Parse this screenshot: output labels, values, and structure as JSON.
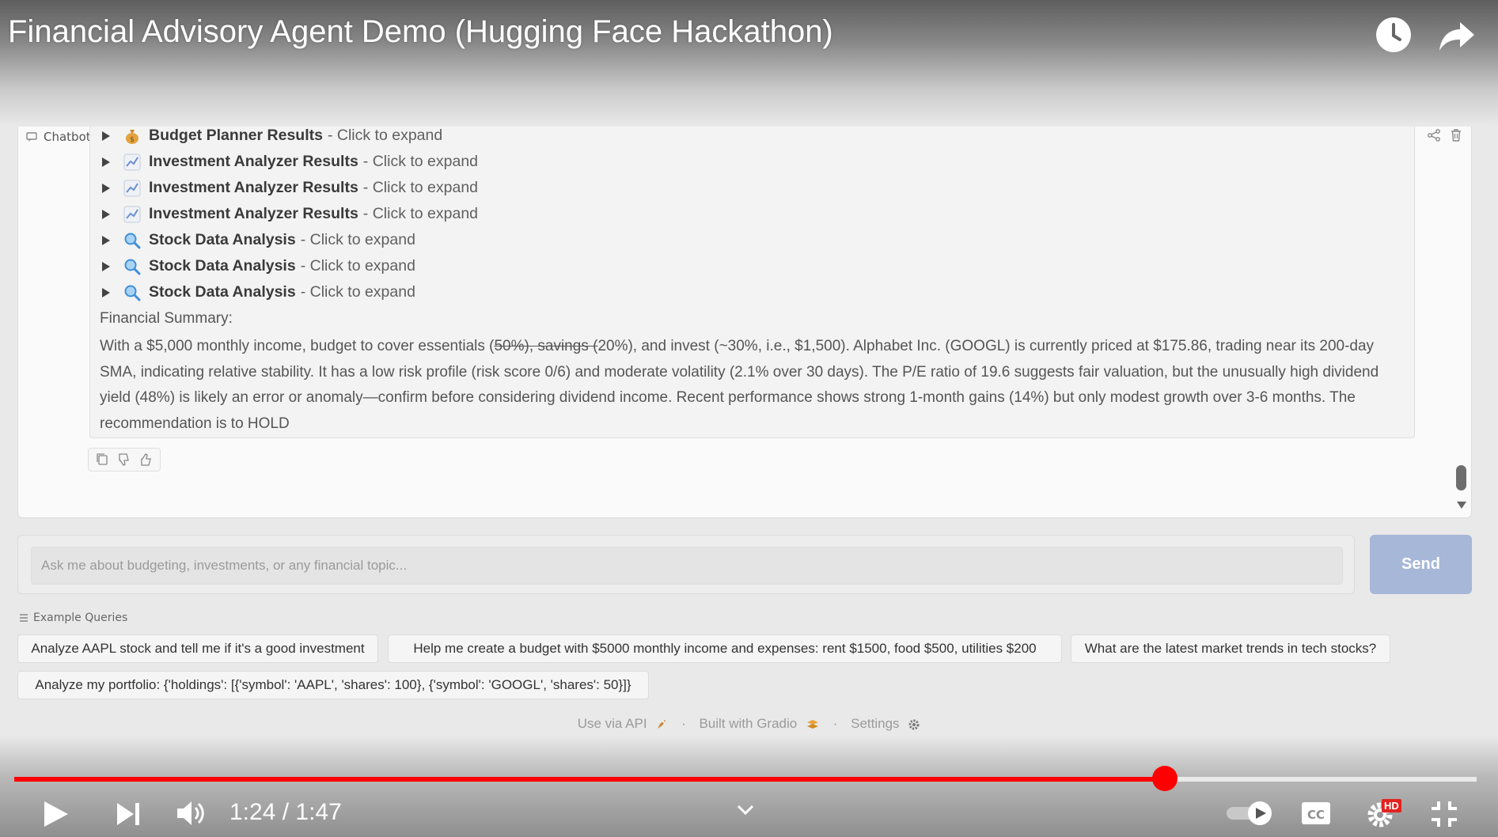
{
  "video": {
    "title": "Financial Advisory Agent Demo (Hugging Face Hackathon)",
    "time": "1:24 / 1:47",
    "progress_percent": 78.6,
    "hd_badge": "HD"
  },
  "chatbot": {
    "label": "Chatbot",
    "details": [
      {
        "icon": "money-bag-icon",
        "title": "Budget Planner Results",
        "hint": "- Click to expand"
      },
      {
        "icon": "chart-icon",
        "title": "Investment Analyzer Results",
        "hint": "- Click to expand"
      },
      {
        "icon": "chart-icon",
        "title": "Investment Analyzer Results",
        "hint": "- Click to expand"
      },
      {
        "icon": "chart-icon",
        "title": "Investment Analyzer Results",
        "hint": "- Click to expand"
      },
      {
        "icon": "magnifier-icon",
        "title": "Stock Data Analysis",
        "hint": "- Click to expand"
      },
      {
        "icon": "magnifier-icon",
        "title": "Stock Data Analysis",
        "hint": "- Click to expand"
      },
      {
        "icon": "magnifier-icon",
        "title": "Stock Data Analysis",
        "hint": "- Click to expand"
      }
    ],
    "summary_title": "Financial Summary:",
    "summary_pre": "With a $5,000 monthly income, budget to cover essentials (",
    "summary_strike": "50%), savings (",
    "summary_post": "20%), and invest (~30%, i.e., $1,500). Alphabet Inc. (GOOGL) is currently priced at $175.86, trading near its 200-day SMA, indicating relative stability. It has a low risk profile (risk score 0/6) and moderate volatility (2.1% over 30 days). The P/E ratio of 19.6 suggests fair valuation, but the unusually high dividend yield (48%) is likely an error or anomaly—confirm before considering dividend income. Recent performance shows strong 1-month gains (14%) but only modest growth over 3-6 months. The recommendation is to HOLD"
  },
  "input": {
    "placeholder": "Ask me about budgeting, investments, or any financial topic...",
    "send_label": "Send"
  },
  "examples": {
    "label": "Example Queries",
    "items": [
      "Analyze AAPL stock and tell me if it's a good investment",
      "Help me create a budget with $5000 monthly income and expenses: rent $1500, food $500, utilities $200",
      "What are the latest market trends in tech stocks?",
      "Analyze my portfolio: {'holdings': [{'symbol': 'AAPL', 'shares': 100}, {'symbol': 'GOOGL', 'shares': 50}]}"
    ]
  },
  "footer": {
    "api": "Use via API",
    "built": "Built with Gradio",
    "settings": "Settings",
    "separator": "·"
  },
  "colors": {
    "progress": "#ff0000",
    "send_button": "#a6b7d8"
  }
}
